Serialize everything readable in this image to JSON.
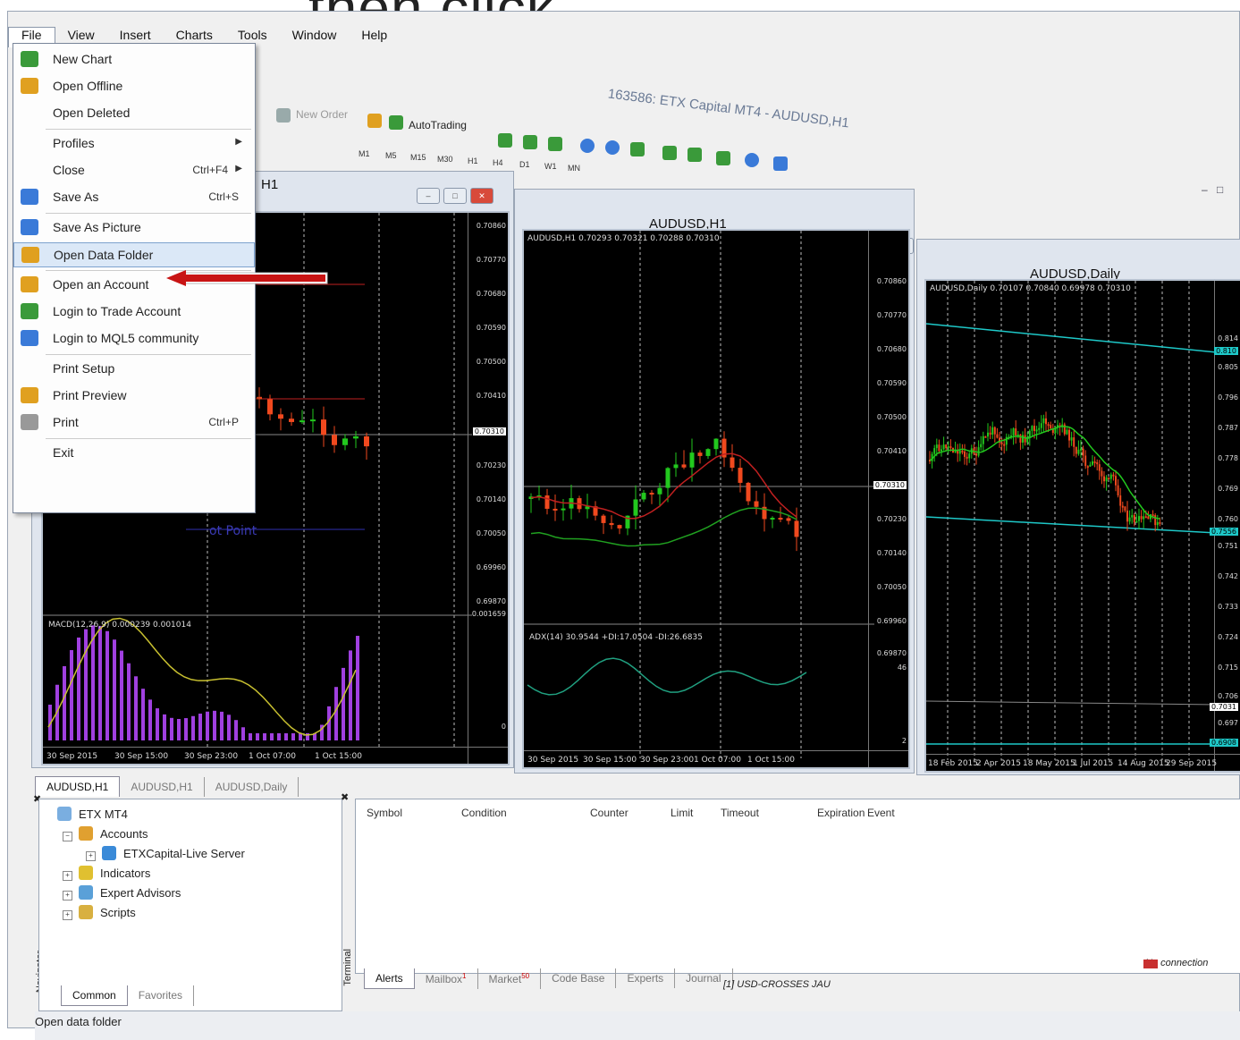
{
  "caption": "then click",
  "window_title": "163586: ETX Capital MT4 - AUDUSD,H1",
  "menubar": [
    "File",
    "View",
    "Insert",
    "Charts",
    "Tools",
    "Window",
    "Help"
  ],
  "toolbar": {
    "new_order": "New Order",
    "autotrading": "AutoTrading",
    "timeframes": [
      "M1",
      "M5",
      "M15",
      "M30",
      "H1",
      "H4",
      "D1",
      "W1",
      "MN"
    ]
  },
  "file_menu": {
    "items": [
      {
        "label": "New Chart",
        "shortcut": "",
        "submenu": false
      },
      {
        "label": "Open Offline",
        "shortcut": "",
        "submenu": false
      },
      {
        "label": "Open Deleted",
        "shortcut": "",
        "submenu": false
      },
      {
        "label": "Profiles",
        "shortcut": "",
        "submenu": true
      },
      {
        "label": "Close",
        "shortcut": "Ctrl+F4",
        "submenu": true
      },
      {
        "label": "Save As",
        "shortcut": "Ctrl+S",
        "submenu": false
      },
      {
        "label": "Save As Picture",
        "shortcut": "",
        "submenu": false
      },
      {
        "label": "Open Data Folder",
        "shortcut": "",
        "submenu": false,
        "highlighted": true
      },
      {
        "label": "Open an Account",
        "shortcut": "",
        "submenu": false
      },
      {
        "label": "Login to Trade Account",
        "shortcut": "",
        "submenu": false
      },
      {
        "label": "Login to MQL5 community",
        "shortcut": "",
        "submenu": false
      },
      {
        "label": "Print Setup",
        "shortcut": "",
        "submenu": false
      },
      {
        "label": "Print Preview",
        "shortcut": "",
        "submenu": false
      },
      {
        "label": "Print",
        "shortcut": "Ctrl+P",
        "submenu": false
      },
      {
        "label": "Exit",
        "shortcut": "",
        "submenu": false
      }
    ]
  },
  "charts": {
    "left": {
      "title": "H1",
      "indicator": "MACD(12,26,9) 0.000239 0.001014",
      "object_label": "ot Point",
      "prices": [
        "0.70860",
        "0.70770",
        "0.70680",
        "0.70590",
        "0.70500",
        "0.70410",
        "0.70310",
        "0.70230",
        "0.70140",
        "0.70050",
        "0.69960",
        "0.69870",
        "0.001659",
        "0"
      ],
      "highlight_price": "0.70310",
      "times": [
        "30 Sep 2015",
        "30 Sep 15:00",
        "30 Sep 23:00",
        "1 Oct 07:00",
        "1 Oct 15:00"
      ]
    },
    "middle": {
      "title": "AUDUSD,H1",
      "info": "AUDUSD,H1  0.70293 0.70321 0.70288 0.70310",
      "indicator": "ADX(14) 30.9544 +DI:17.0504 -DI:26.6835",
      "prices": [
        "0.70860",
        "0.70770",
        "0.70680",
        "0.70590",
        "0.70500",
        "0.70410",
        "0.70310",
        "0.70230",
        "0.70140",
        "0.70050",
        "0.69960",
        "0.69870",
        "46",
        "2"
      ],
      "highlight_price": "0.70310",
      "times": [
        "30 Sep 2015",
        "30 Sep 15:00",
        "30 Sep 23:00",
        "1 Oct 07:00",
        "1 Oct 15:00"
      ]
    },
    "right": {
      "title": "AUDUSD,Daily",
      "info": "AUDUSD,Daily  0.70107 0.70840 0.69978 0.70310",
      "prices": [
        "0.814",
        "0.810",
        "0.805",
        "0.796",
        "0.787",
        "0.778",
        "0.769",
        "0.760",
        "0.7556",
        "0.751",
        "0.742",
        "0.733",
        "0.724",
        "0.715",
        "0.706",
        "0.7031",
        "0.697",
        "0.6908"
      ],
      "times": [
        "18 Feb 2015",
        "2 Apr 2015",
        "18 May 2015",
        "1 Jul 2015",
        "14 Aug 2015",
        "29 Sep 2015"
      ]
    }
  },
  "chart_tabs": [
    "AUDUSD,H1",
    "AUDUSD,H1",
    "AUDUSD,Daily"
  ],
  "navigator": {
    "root": "ETX MT4",
    "items": [
      "Accounts",
      "ETXCapital-Live Server",
      "Indicators",
      "Expert Advisors",
      "Scripts"
    ],
    "side_label": "Navigator",
    "tabs": [
      "Common",
      "Favorites"
    ]
  },
  "terminal": {
    "side_label": "Terminal",
    "columns": [
      "Symbol",
      "Condition",
      "Counter",
      "Limit",
      "Timeout",
      "Expiration",
      "Event"
    ],
    "tabs": [
      "Alerts",
      "Mailbox",
      "Market",
      "Code Base",
      "Experts",
      "Journal"
    ],
    "mailbox_badge": "1",
    "market_badge": "50"
  },
  "status": {
    "left": "Open data folder",
    "profile": "[1] USD-CROSSES JAU",
    "connection": "No connection"
  },
  "colors": {
    "bull": "#22c81e",
    "bear": "#f0491e",
    "macd": "#a040e0",
    "signal": "#c8c030",
    "cyan": "#1ec8c8",
    "arrow": "#c81414"
  }
}
